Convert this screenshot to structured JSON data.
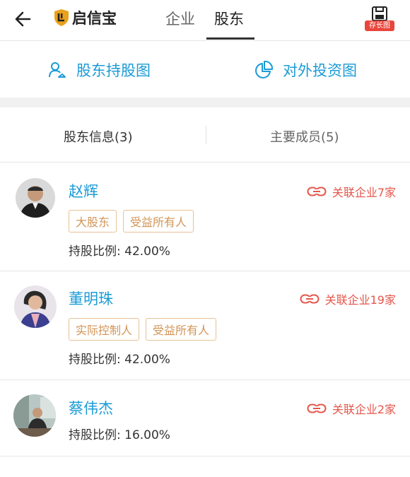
{
  "header": {
    "logo_text": "启信宝",
    "tabs": [
      {
        "label": "企业",
        "active": false
      },
      {
        "label": "股东",
        "active": true
      }
    ],
    "save_badge": "存长图"
  },
  "links": [
    {
      "label": "股东持股图",
      "icon": "person-network-icon"
    },
    {
      "label": "对外投资图",
      "icon": "pie-chart-icon"
    }
  ],
  "subtabs": [
    {
      "label": "股东信息(3)",
      "active": true
    },
    {
      "label": "主要成员(5)",
      "active": false
    }
  ],
  "shareholders": [
    {
      "name": "赵辉",
      "related": "关联企业7家",
      "tags": [
        "大股东",
        "受益所有人"
      ],
      "ratio_label": "持股比例: 42.00%"
    },
    {
      "name": "董明珠",
      "related": "关联企业19家",
      "tags": [
        "实际控制人",
        "受益所有人"
      ],
      "ratio_label": "持股比例: 42.00%"
    },
    {
      "name": "蔡伟杰",
      "related": "关联企业2家",
      "tags": [],
      "ratio_label": "持股比例: 16.00%"
    }
  ],
  "colors": {
    "accent_blue": "#1b9bd6",
    "related_red": "#e4574c",
    "tag_orange": "#d29456",
    "badge_red": "#e8463c"
  }
}
